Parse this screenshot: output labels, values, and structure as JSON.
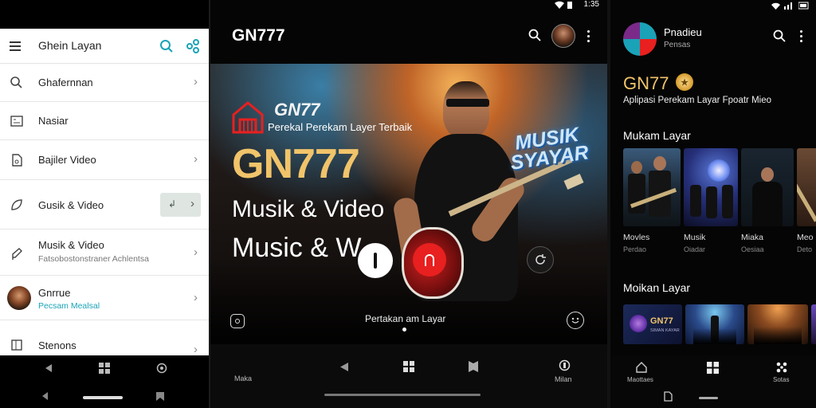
{
  "panel1": {
    "appbar_title": "Ghein Layan",
    "items": [
      {
        "label": "Ghafernnan",
        "sub": "",
        "icon": "search-icon"
      },
      {
        "label": "Nasiar",
        "sub": "",
        "icon": "keyboard-icon"
      },
      {
        "label": "Bajiler Video",
        "sub": "",
        "icon": "video-file-icon"
      },
      {
        "label": "Gusik & Video",
        "sub": "",
        "icon": "leaf-icon",
        "action": "↲"
      },
      {
        "label": "Musik & Video",
        "sub": "Fatsobostonstraner Achlentsa",
        "icon": "edit-icon"
      },
      {
        "label": "Gnrrue",
        "sub": "Pecsam Mealsal",
        "icon": "avatar"
      },
      {
        "label": "Stenons",
        "sub": "",
        "icon": "calendar-icon"
      }
    ]
  },
  "panel2": {
    "status_time": "1:35",
    "app_title": "GN777",
    "hero": {
      "logo": "GN77",
      "tagline": "Perekal Perekam Layer Terbaik",
      "brand": "GN777",
      "line1": "Musik & Video",
      "line2": "Music & W",
      "badge": "MUSIK SYAYAR",
      "caption": "Pertakan am Layar"
    },
    "nav": {
      "left_label": "Maka",
      "right_label": "Milan"
    }
  },
  "panel3": {
    "profile_name": "Pnadieu",
    "profile_sub": "Pensas",
    "brand": "GN77",
    "description": "Aplipasi Perekam Layar Fpoatr Mieo",
    "section1": "Mukam Layar",
    "cards": [
      {
        "title": "Movles",
        "sub": "Perdao"
      },
      {
        "title": "Musik",
        "sub": "Oiadar"
      },
      {
        "title": "Miaka",
        "sub": "Oesiaa"
      },
      {
        "title": "Meo",
        "sub": "Deto"
      }
    ],
    "section2": "Moikan Layar",
    "card2_label": "GN77",
    "card2_sub": "SIMAN KAYAR",
    "nav": {
      "left_label": "Maottaes",
      "right_label": "Sotas"
    }
  },
  "colors": {
    "accent": "#e8201f",
    "teal": "#1aa3b8",
    "gold": "#f1c46a"
  }
}
